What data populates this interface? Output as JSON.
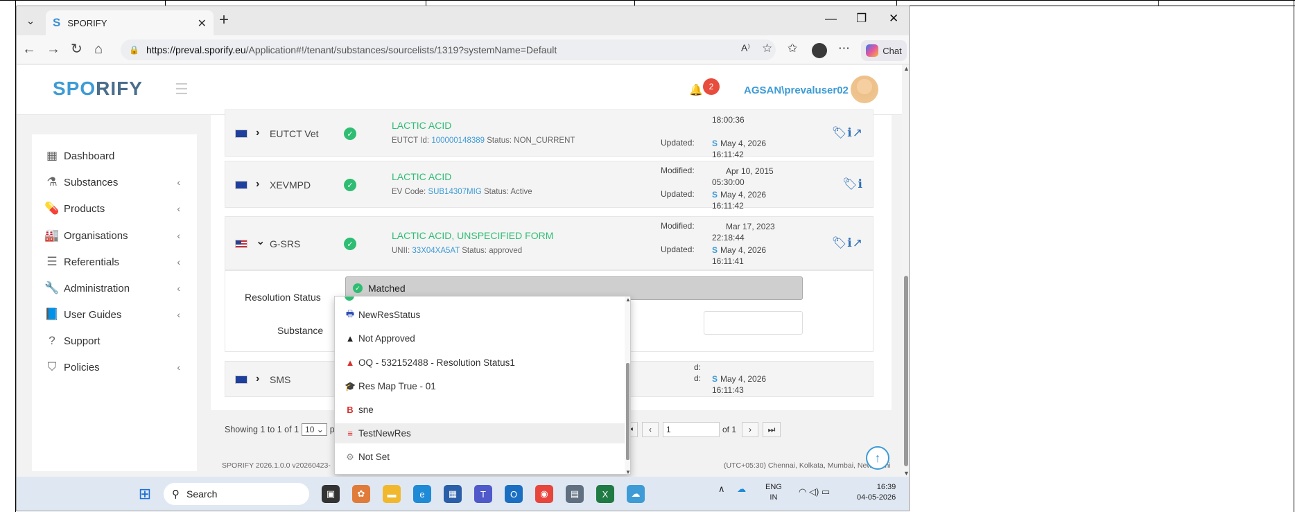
{
  "browser": {
    "tab_title": "SPORIFY",
    "tab_logo": "S",
    "url_domain": "https://preval.sporify.eu",
    "url_path": "/Application#!/tenant/substances/sourcelists/1319?systemName=Default",
    "chat_label": "Chat"
  },
  "app": {
    "logo_a": "SP",
    "logo_b": "O",
    "logo_c": "RIFY",
    "notification_count": "2",
    "username": "AGSAN\\prevaluser02"
  },
  "sidebar": {
    "items": [
      {
        "label": "Dashboard",
        "icon": "dashboard-icon",
        "glyph": "▦"
      },
      {
        "label": "Substances",
        "icon": "flask-icon",
        "glyph": "⚗"
      },
      {
        "label": "Products",
        "icon": "pills-icon",
        "glyph": "💊"
      },
      {
        "label": "Organisations",
        "icon": "industry-icon",
        "glyph": "🏭"
      },
      {
        "label": "Referentials",
        "icon": "list-icon",
        "glyph": "☰"
      },
      {
        "label": "Administration",
        "icon": "wrench-icon",
        "glyph": "🔧"
      },
      {
        "label": "User Guides",
        "icon": "book-icon",
        "glyph": "📘"
      },
      {
        "label": "Support",
        "icon": "question-icon",
        "glyph": "?"
      },
      {
        "label": "Policies",
        "icon": "shield-icon",
        "glyph": "⛉"
      }
    ],
    "chevron": "‹"
  },
  "rows": [
    {
      "source": "EUTCT Vet",
      "flag": "eu",
      "expanded": false,
      "substance": "LACTIC ACID",
      "id_label": "EUTCT Id:",
      "id_value": "100000148389",
      "status_text": "Status: NON_CURRENT",
      "modified_label": "",
      "modified_date": "",
      "modified_time": "18:00:36",
      "updated_label": "Updated:",
      "updated_date": "May 4, 2026",
      "updated_time": "16:11:42",
      "actions": "🏷ℹ↗"
    },
    {
      "source": "XEVMPD",
      "flag": "eu",
      "expanded": false,
      "substance": "LACTIC ACID",
      "id_label": "EV Code:",
      "id_value": "SUB14307MIG",
      "status_text": "Status: Active",
      "modified_label": "Modified:",
      "modified_date": "Apr 10, 2015",
      "modified_time": "05:30:00",
      "updated_label": "Updated:",
      "updated_date": "May 4, 2026",
      "updated_time": "16:11:42",
      "actions": "🏷ℹ"
    },
    {
      "source": "G-SRS",
      "flag": "us",
      "expanded": true,
      "substance": "LACTIC ACID, UNSPECIFIED FORM",
      "id_label": "UNII:",
      "id_value": "33X04XA5AT",
      "status_text": "Status: approved",
      "modified_label": "Modified:",
      "modified_date": "Mar 17, 2023",
      "modified_time": "22:18:44",
      "updated_label": "Updated:",
      "updated_date": "May 4, 2026",
      "updated_time": "16:11:41",
      "actions": "🏷ℹ↗"
    },
    {
      "source": "SMS",
      "flag": "eu",
      "expanded": false,
      "modified_partial": "d:",
      "updated_partial": "d:",
      "updated_date": "May 4, 2026",
      "updated_time": "16:11:43"
    }
  ],
  "detail": {
    "resolution_label": "Resolution Status",
    "resolution_value": "Matched",
    "substance_label": "Substance"
  },
  "dropdown": {
    "items": [
      {
        "label": "NewResStatus",
        "icon": "printer-icon",
        "glyph": "🖶",
        "color": "#2f4fb5"
      },
      {
        "label": "Not Approved",
        "icon": "warning-black-icon",
        "glyph": "▲",
        "color": "#222"
      },
      {
        "label": "OQ - 532152488 - Resolution Status1",
        "icon": "warning-red-icon",
        "glyph": "▲",
        "color": "#d9302c"
      },
      {
        "label": "Res Map True - 01",
        "icon": "graduation-icon",
        "glyph": "🎓",
        "color": "#2bb3c8"
      },
      {
        "label": "sne",
        "icon": "bold-b-icon",
        "glyph": "B",
        "color": "#d9302c"
      },
      {
        "label": "TestNewRes",
        "icon": "strikethrough-icon",
        "glyph": "≡",
        "color": "#d9302c"
      },
      {
        "label": "Not Set",
        "icon": "gear-icon",
        "glyph": "⚙",
        "color": "#888"
      }
    ]
  },
  "paging": {
    "showing_text": "Showing 1 to 1 of 1",
    "page_size": "10",
    "per_partial": "pe",
    "page_value": "1",
    "of_text": "of 1"
  },
  "footer": {
    "version": "SPORIFY 2026.1.0.0 v20260423-",
    "timezone": "(UTC+05:30) Chennai, Kolkata, Mumbai, New Delhi"
  },
  "taskbar": {
    "search_placeholder": "Search",
    "lang_line1": "ENG",
    "lang_line2": "IN",
    "time": "16:39",
    "date": "04-05-2026"
  },
  "colors": {
    "accent": "#3d9bd6",
    "success": "#2ebd73",
    "badge": "#e74c3c"
  }
}
